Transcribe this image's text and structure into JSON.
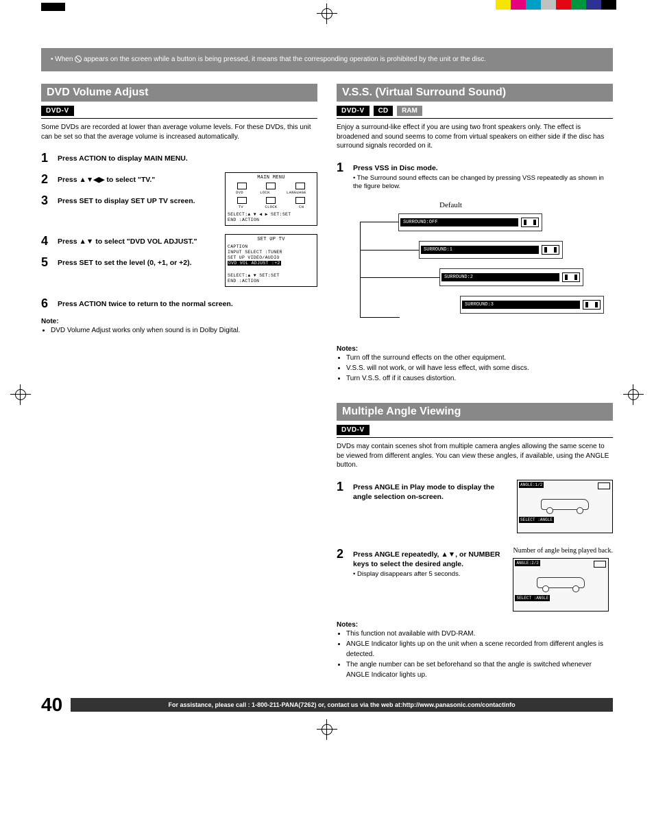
{
  "banner": {
    "text": "When      appears on the screen while a button is being pressed, it means that the corresponding operation is prohibited by the unit or the disc."
  },
  "left": {
    "heading": "DVD Volume Adjust",
    "badges": [
      "DVD-V"
    ],
    "intro": "Some DVDs are recorded at lower than average volume levels. For these DVDs, this unit can be set so that the average volume is increased automatically.",
    "steps": [
      {
        "n": "1",
        "body": "Press ACTION to display MAIN MENU."
      },
      {
        "n": "2",
        "body": "Press ▲▼◀▶ to select \"TV.\""
      },
      {
        "n": "3",
        "body": "Press SET to display SET UP TV screen."
      },
      {
        "n": "4",
        "body": "Press ▲▼ to select \"DVD VOL ADJUST.\""
      },
      {
        "n": "5",
        "body": "Press SET to set the level (0, +1, or +2)."
      },
      {
        "n": "6",
        "body": "Press ACTION twice to return to the normal screen."
      }
    ],
    "osd1": {
      "title": "MAIN MENU",
      "row1": [
        "DVD",
        "LOCK",
        "LANGUAGE"
      ],
      "row2": [
        "TV",
        "CLOCK",
        "CH"
      ],
      "footer1": "SELECT:▲ ▼ ◀ ▶  SET:SET",
      "footer2": "END   :ACTION"
    },
    "osd2": {
      "title": "SET UP TV",
      "lines": [
        "CAPTION",
        "INPUT SELECT   :TUNER",
        "SET UP VIDEO/AUDIO"
      ],
      "highlight": "DVD VOL ADJUST :+2",
      "footer1": "SELECT:▲ ▼       SET:SET",
      "footer2": "END   :ACTION"
    },
    "note_h": "Note:",
    "note_items": [
      "DVD Volume Adjust works only when sound is in Dolby Digital."
    ]
  },
  "vss": {
    "heading": "V.S.S. (Virtual Surround Sound)",
    "badges": [
      "DVD-V",
      "CD",
      "RAM"
    ],
    "intro": "Enjoy a surround-like effect if you are using two front speakers only. The effect is broadened and sound seems to come from virtual speakers on either side if the disc has surround signals recorded on it.",
    "step1": {
      "n": "1",
      "body": "Press VSS in Disc mode.",
      "sub": "The Surround sound effects can be changed by pressing VSS repeatedly as shown in the figure below."
    },
    "default_label": "Default",
    "modes": [
      "SURROUND:OFF",
      "SURROUND:1",
      "SURROUND:2",
      "SURROUND:3"
    ],
    "notes_h": "Notes:",
    "notes": [
      "Turn off the surround effects on the other equipment.",
      "V.S.S. will not work, or will have less effect, with some discs.",
      "Turn V.S.S. off if it causes distortion."
    ]
  },
  "angle": {
    "heading": "Multiple Angle Viewing",
    "badges": [
      "DVD-V"
    ],
    "intro": "DVDs may contain scenes shot from multiple camera angles allowing the same scene to be viewed from different angles. You can view these angles, if available, using the ANGLE button.",
    "step1": {
      "n": "1",
      "body": "Press ANGLE in Play mode to display the angle selection on-screen."
    },
    "step2": {
      "n": "2",
      "body": "Press ANGLE repeatedly, ▲▼, or NUMBER keys to select the desired angle.",
      "sub": "Display disappears after 5 seconds."
    },
    "fig1_angle": "ANGLE:1/2",
    "fig1_select": "SELECT :ANGLE",
    "fig2_caption": "Number of angle being played back.",
    "fig2_angle": "ANGLE:2/2",
    "fig2_select": "SELECT :ANGLE",
    "notes_h": "Notes:",
    "notes": [
      "This function not available with DVD-RAM.",
      "ANGLE Indicator lights up on the unit when a scene recorded from different angles is detected.",
      "The angle number can be set beforehand so that the angle is switched whenever ANGLE Indicator lights up."
    ]
  },
  "footer": {
    "page": "40",
    "text": "For assistance, please call : 1-800-211-PANA(7262) or, contact us via the web at:http://www.panasonic.com/contactinfo"
  },
  "colors": [
    "#f6e500",
    "#e6007e",
    "#00a0c6",
    "#c0c0c0",
    "#e30613",
    "#009640",
    "#2e3192",
    "#000000"
  ]
}
